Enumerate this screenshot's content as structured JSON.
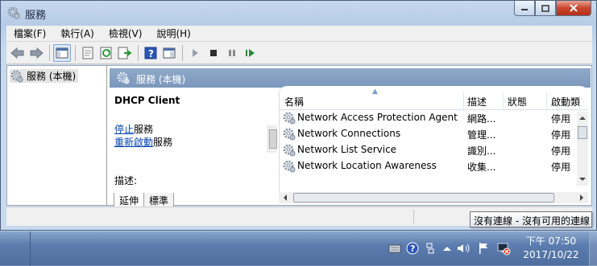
{
  "window": {
    "title": "服務"
  },
  "menu": [
    "檔案(F)",
    "執行(A)",
    "檢視(V)",
    "說明(H)"
  ],
  "toolbar": {
    "buttons": [
      "back-icon",
      "forward-icon",
      "show-hide-console-tree-icon",
      "properties-icon",
      "refresh-icon",
      "export-list-icon",
      "help-icon",
      "action-pane-icon",
      "start-service-icon",
      "stop-service-icon",
      "pause-service-icon",
      "restart-service-icon"
    ]
  },
  "tree": {
    "root_label": "服務 (本機)"
  },
  "header": {
    "title": "服務 (本機)"
  },
  "detail": {
    "service_name": "DHCP Client",
    "stop_link": "停止",
    "stop_suffix": "服務",
    "restart_link": "重新啟動",
    "restart_suffix": "服務",
    "desc_label": "描述:"
  },
  "tabs": [
    "延伸",
    "標準"
  ],
  "grid": {
    "columns": [
      "名稱",
      "描述",
      "狀態",
      "啟動類"
    ],
    "rows": [
      {
        "name": "Network Access Protection Agent",
        "desc": "網路...",
        "status": "",
        "startup": "停用"
      },
      {
        "name": "Network Connections",
        "desc": "管理...",
        "status": "",
        "startup": "停用"
      },
      {
        "name": "Network List Service",
        "desc": "識別...",
        "status": "",
        "startup": "停用"
      },
      {
        "name": "Network Location Awareness",
        "desc": "收集...",
        "status": "",
        "startup": "停用"
      }
    ]
  },
  "tooltip": "沒有連線 - 沒有可用的連線",
  "clock": {
    "time": "下午 07:50",
    "date": "2017/10/22"
  },
  "colors": {
    "accent": "#7b97bc",
    "link": "#0645ad",
    "close": "#c8452c"
  }
}
